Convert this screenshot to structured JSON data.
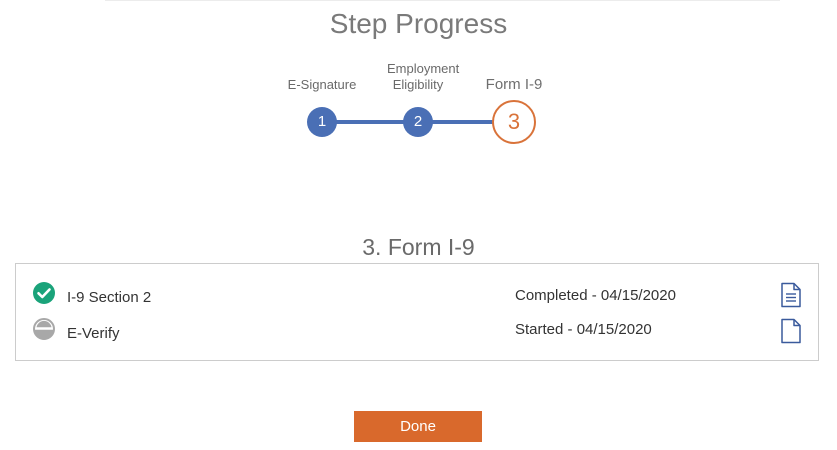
{
  "page": {
    "title": "Step Progress"
  },
  "stepper": {
    "steps": [
      {
        "number": "1",
        "label": "E-Signature",
        "state": "complete"
      },
      {
        "number": "2",
        "label": "Employment Eligibility",
        "state": "complete"
      },
      {
        "number": "3",
        "label": "Form I-9",
        "state": "current"
      }
    ],
    "colors": {
      "complete": "#4a6fb5",
      "current": "#d9733a"
    }
  },
  "section": {
    "heading": "3. Form I-9",
    "items": [
      {
        "name": "I-9 Section 2",
        "status": "Completed - 04/15/2020",
        "status_icon": "check-circle-icon",
        "doc_icon": "document-lines-icon",
        "status_color": "#1aa37a"
      },
      {
        "name": "E-Verify",
        "status": "Started - 04/15/2020",
        "status_icon": "half-circle-icon",
        "doc_icon": "document-blank-icon",
        "status_color": "#a8a8a8"
      }
    ]
  },
  "actions": {
    "done_label": "Done",
    "done_color": "#d9692c"
  }
}
